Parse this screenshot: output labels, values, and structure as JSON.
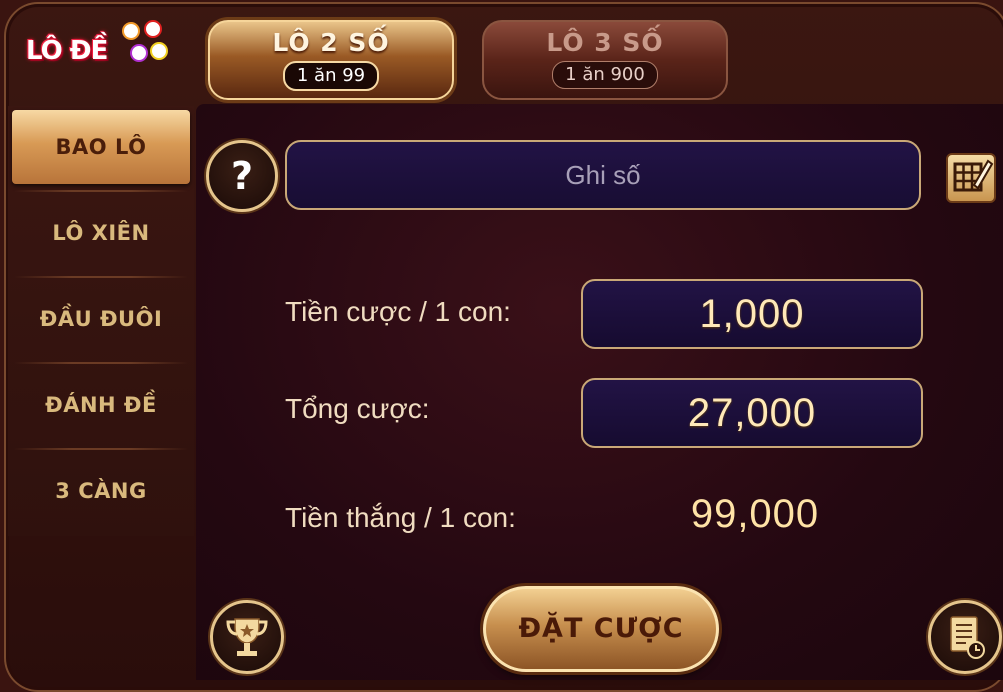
{
  "logo": {
    "text": "LÔ ĐỀ"
  },
  "tabs": [
    {
      "label": "LÔ 2 SỐ",
      "odds": "1 ăn 99",
      "active": true
    },
    {
      "label": "LÔ 3 SỐ",
      "odds": "1 ăn 900",
      "active": false
    }
  ],
  "sidebar": {
    "items": [
      {
        "label": "BAO LÔ",
        "active": true
      },
      {
        "label": "LÔ XIÊN",
        "active": false
      },
      {
        "label": "ĐẦU ĐUÔI",
        "active": false
      },
      {
        "label": "ĐÁNH ĐỀ",
        "active": false
      },
      {
        "label": "3 CÀNG",
        "active": false
      }
    ]
  },
  "main": {
    "help_label": "?",
    "number_placeholder": "Ghi số",
    "stake_label": "Tiền cược / 1 con:",
    "stake_value": "1,000",
    "total_label": "Tổng cược:",
    "total_value": "27,000",
    "win_label": "Tiền thắng / 1 con:",
    "win_value": "99,000",
    "bet_button": "ĐẶT CƯỢC"
  },
  "icons": {
    "help": "question-icon",
    "grid": "grid-pencil-icon",
    "trophy": "trophy-icon",
    "history": "history-icon"
  },
  "colors": {
    "gold": "#e5c58c",
    "panel": "#240811",
    "input_bg": "#1c0f3c"
  }
}
